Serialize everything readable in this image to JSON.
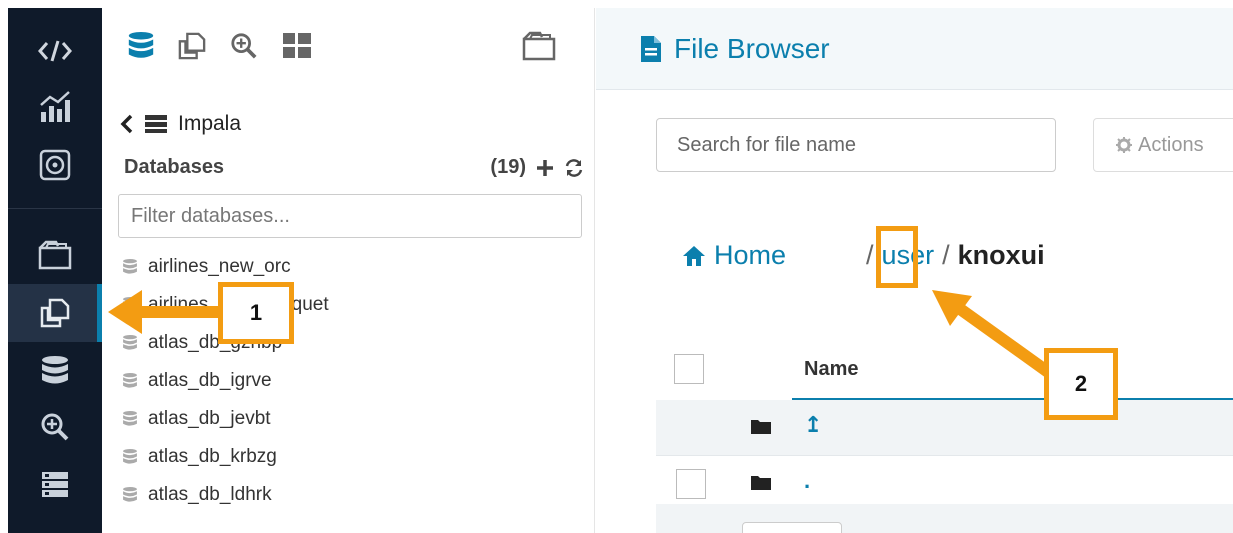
{
  "rail": {
    "items": [
      {
        "name": "code-icon"
      },
      {
        "name": "dashboard-chart-icon"
      },
      {
        "name": "scheduler-icon"
      },
      {
        "name": "file-browser-icon"
      },
      {
        "name": "copy-files-icon",
        "active": true
      },
      {
        "name": "database-icon"
      },
      {
        "name": "search-plus-icon"
      },
      {
        "name": "server-icon"
      }
    ]
  },
  "assist": {
    "back_label": "Impala",
    "databases_label": "Databases",
    "db_count": "(19)",
    "filter_placeholder": "Filter databases...",
    "databases": [
      "airlines_new_orc",
      "airlines_new_parquet",
      "atlas_db_gzhbp",
      "atlas_db_igrve",
      "atlas_db_jevbt",
      "atlas_db_krbzg",
      "atlas_db_ldhrk"
    ]
  },
  "main": {
    "title": "File Browser",
    "search_placeholder": "Search for file name",
    "actions_label": "Actions",
    "breadcrumb": {
      "home": "Home",
      "root": "/",
      "user": "user",
      "separator": "/",
      "current": "knoxui"
    },
    "table": {
      "name_header": "Name",
      "rows": [
        {
          "name": "↥"
        },
        {
          "name": "."
        }
      ]
    }
  },
  "annotations": {
    "callout_1": "1",
    "callout_2": "2"
  },
  "colors": {
    "accent": "#0b7fad",
    "annotation": "#f39c12",
    "rail_bg": "#0f1a2a"
  }
}
